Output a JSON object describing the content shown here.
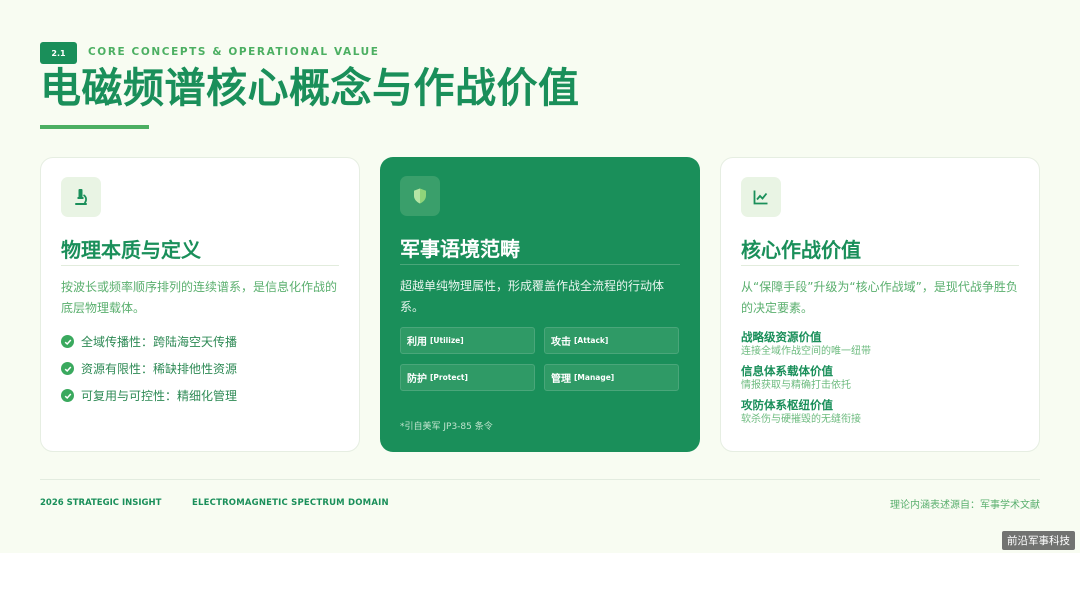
{
  "header": {
    "section_number": "2.1",
    "eyebrow": "CORE CONCEPTS & OPERATIONAL VALUE",
    "title": "电磁频谱核心概念与作战价值"
  },
  "cards": [
    {
      "icon": "microscope-icon",
      "title": "物理本质与定义",
      "description": "按波长或频率顺序排列的连续谱系，是信息化作战的底层物理载体。",
      "bullets": [
        "全域传播性：跨陆海空天传播",
        "资源有限性：稀缺排他性资源",
        "可复用与可控性：精细化管理"
      ]
    },
    {
      "icon": "shield-icon",
      "title": "军事语境范畴",
      "description": "超越单纯物理属性，形成覆盖作战全流程的行动体系。",
      "actions": [
        {
          "cn": "利用",
          "en": "[Utilize]"
        },
        {
          "cn": "攻击",
          "en": "[Attack]"
        },
        {
          "cn": "防护",
          "en": "[Protect]"
        },
        {
          "cn": "管理",
          "en": "[Manage]"
        }
      ],
      "note": "*引自美军 JP3-85 条令"
    },
    {
      "icon": "line-chart-icon",
      "title": "核心作战价值",
      "description": "从“保障手段”升级为“核心作战域”，是现代战争胜负的决定要素。",
      "values": [
        {
          "title": "战略级资源价值",
          "sub": "连接全域作战空间的唯一纽带"
        },
        {
          "title": "信息体系载体价值",
          "sub": "情报获取与精确打击依托"
        },
        {
          "title": "攻防体系枢纽价值",
          "sub": "软杀伤与硬摧毁的无缝衔接"
        }
      ]
    }
  ],
  "footer": {
    "left": "2026 STRATEGIC INSIGHT",
    "middle": "ELECTROMAGNETIC SPECTRUM DOMAIN",
    "right": "理论内涵表述源自：军事学术文献"
  },
  "watermark": "前沿军事科技",
  "colors": {
    "primary": "#1a8f5a",
    "accent": "#4caf62",
    "background": "#f8fcf2"
  }
}
